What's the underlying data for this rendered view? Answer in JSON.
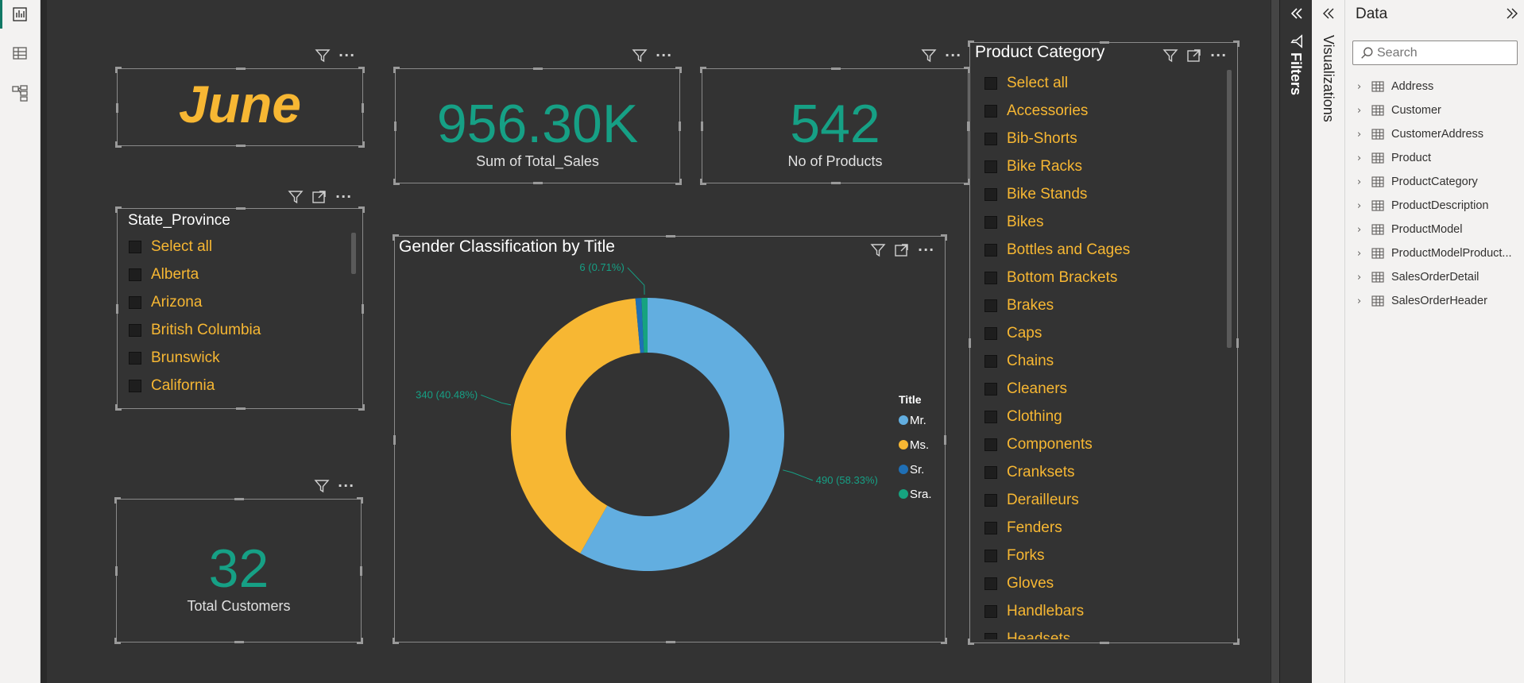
{
  "cards": {
    "month": {
      "value": "June"
    },
    "sales": {
      "value": "956.30K",
      "label": "Sum of Total_Sales"
    },
    "products": {
      "value": "542",
      "label": "No of Products"
    },
    "customers": {
      "value": "32",
      "label": "Total Customers"
    }
  },
  "state_slicer": {
    "title": "State_Province",
    "items": [
      "Select all",
      "Alberta",
      "Arizona",
      "British Columbia",
      "Brunswick",
      "California"
    ]
  },
  "category_slicer": {
    "title": "Product Category",
    "items": [
      "Select all",
      "Accessories",
      "Bib-Shorts",
      "Bike Racks",
      "Bike Stands",
      "Bikes",
      "Bottles and Cages",
      "Bottom Brackets",
      "Brakes",
      "Caps",
      "Chains",
      "Cleaners",
      "Clothing",
      "Components",
      "Cranksets",
      "Derailleurs",
      "Fenders",
      "Forks",
      "Gloves",
      "Handlebars",
      "Headsets"
    ]
  },
  "chart_data": {
    "type": "pie",
    "title": "Gender Classification by Title",
    "legend_title": "Title",
    "legend_position": "right",
    "donut": true,
    "categories": [
      "Mr.",
      "Ms.",
      "Sr.",
      "Sra."
    ],
    "values": [
      490,
      340,
      6,
      6
    ],
    "colors": [
      "#62aee0",
      "#f7b733",
      "#1f6fb5",
      "#16a37f"
    ],
    "data_labels": [
      "490 (58.33%)",
      "340 (40.48%)",
      "",
      "6 (0.71%)"
    ]
  },
  "panes": {
    "filters_label": "Filters",
    "visualizations_label": "Visualizations",
    "data_title": "Data",
    "search_placeholder": "Search",
    "tables": [
      "Address",
      "Customer",
      "CustomerAddress",
      "Product",
      "ProductCategory",
      "ProductDescription",
      "ProductModel",
      "ProductModelProduct...",
      "SalesOrderDetail",
      "SalesOrderHeader"
    ]
  },
  "colors": {
    "accent_orange": "#f7b733",
    "accent_teal": "#16a085",
    "canvas": "#333333"
  }
}
